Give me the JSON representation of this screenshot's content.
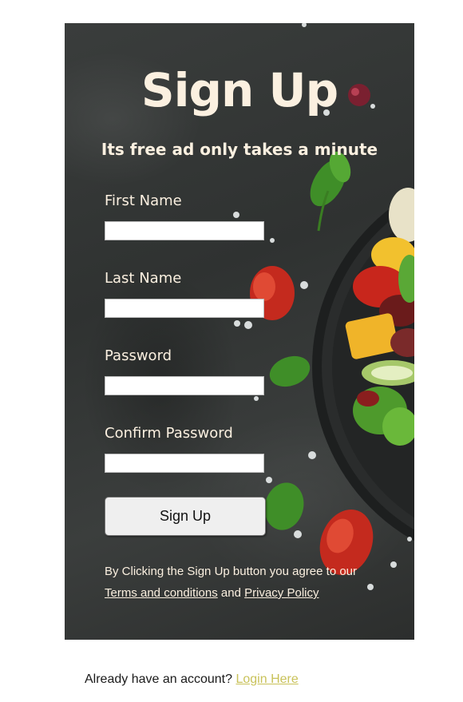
{
  "form": {
    "title": "Sign Up",
    "subtitle": "Its free ad only takes a minute",
    "fields": [
      {
        "label": "First Name",
        "value": ""
      },
      {
        "label": "Last Name",
        "value": ""
      },
      {
        "label": "Password",
        "value": ""
      },
      {
        "label": "Confirm Password",
        "value": ""
      }
    ],
    "submit_label": "Sign Up",
    "terms_prefix": "By Clicking the Sign Up button you agree to our",
    "terms_link": "Terms and conditions",
    "terms_and": "and",
    "privacy_link": "Privacy Policy"
  },
  "footer": {
    "prompt": "Already have an account?",
    "login_link": "Login Here"
  },
  "colors": {
    "text_cream": "#fbf0e0",
    "link_gold": "#c9c25a",
    "background_dark": "#333635"
  },
  "background_image": "dark stone surface with salad plate, cherry tomatoes, basil leaves and salt crystals"
}
